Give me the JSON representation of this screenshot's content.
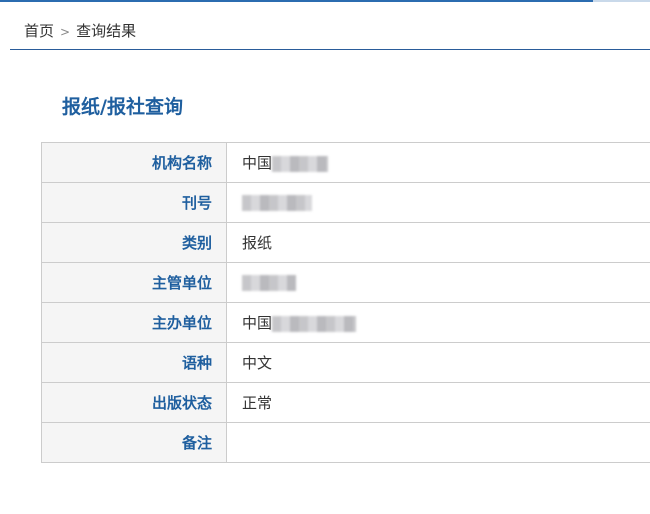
{
  "breadcrumb": {
    "home": "首页",
    "sep": ">",
    "current": "查询结果"
  },
  "title": "报纸/报社查询",
  "rows": [
    {
      "label": "机构名称",
      "value": "中国"
    },
    {
      "label": "刊号",
      "value": ""
    },
    {
      "label": "类别",
      "value": "报纸"
    },
    {
      "label": "主管单位",
      "value": ""
    },
    {
      "label": "主办单位",
      "value": "中国"
    },
    {
      "label": "语种",
      "value": "中文"
    },
    {
      "label": "出版状态",
      "value": "正常"
    },
    {
      "label": "备注",
      "value": ""
    }
  ]
}
